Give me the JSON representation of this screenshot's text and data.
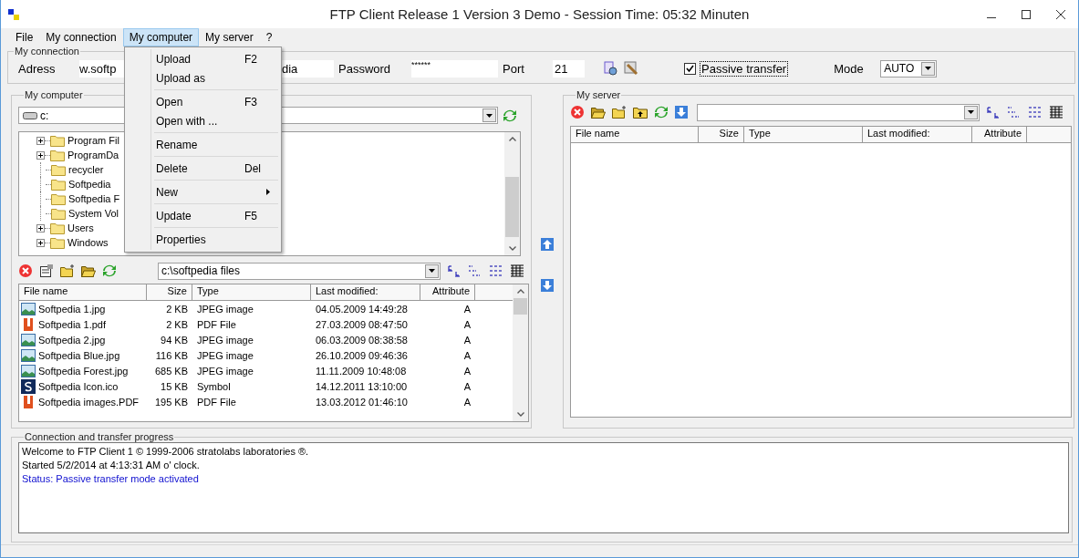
{
  "window": {
    "title": "FTP Client Release 1 Version 3 Demo - Session Time: 05:32 Minuten"
  },
  "menubar": [
    {
      "label": "File",
      "selected": false
    },
    {
      "label": "My connection",
      "selected": false
    },
    {
      "label": "My computer",
      "selected": true
    },
    {
      "label": "My server",
      "selected": false
    },
    {
      "label": "?",
      "selected": false
    }
  ],
  "menu": {
    "groups": [
      [
        {
          "label": "Upload",
          "shortcut": "F2",
          "submenu": false
        },
        {
          "label": "Upload as",
          "submenu": false
        }
      ],
      [
        {
          "label": "Open",
          "shortcut": "F3",
          "submenu": false
        },
        {
          "label": "Open with ...",
          "submenu": false
        }
      ],
      [
        {
          "label": "Rename",
          "submenu": false
        }
      ],
      [
        {
          "label": "Delete",
          "shortcut": "Del",
          "submenu": false
        }
      ],
      [
        {
          "label": "New",
          "submenu": true
        }
      ],
      [
        {
          "label": "Update",
          "shortcut": "F5",
          "submenu": false
        }
      ],
      [
        {
          "label": "Properties",
          "submenu": false
        }
      ]
    ]
  },
  "connection": {
    "title": "My connection",
    "address_label": "Adress",
    "address": "w.softp",
    "user": "dia",
    "password_label": "Password",
    "password": "******",
    "port_label": "Port",
    "port": "21",
    "passive": {
      "label": "Passive transfer",
      "checked": true
    },
    "mode_label": "Mode",
    "mode": "AUTO"
  },
  "left_panel": {
    "title": "My computer",
    "drive": "c:",
    "tree": [
      {
        "label": "Program Fil",
        "expandable": true
      },
      {
        "label": "ProgramDa",
        "expandable": true
      },
      {
        "label": "recycler",
        "expandable": false
      },
      {
        "label": "Softpedia",
        "expandable": false
      },
      {
        "label": "Softpedia F",
        "expandable": false
      },
      {
        "label": "System Vol",
        "expandable": false
      },
      {
        "label": "Users",
        "expandable": true
      },
      {
        "label": "Windows",
        "expandable": true
      }
    ],
    "path": "c:\\softpedia files",
    "columns": [
      "File name",
      "Size",
      "Type",
      "Last modified:",
      "Attribute"
    ],
    "rows": [
      {
        "kind": "image",
        "name": "Softpedia 1.jpg",
        "size": "2 KB",
        "type": "JPEG image",
        "modified": "04.05.2009 14:49:28",
        "attribute": "A"
      },
      {
        "kind": "pdf",
        "name": "Softpedia 1.pdf",
        "size": "2 KB",
        "type": "PDF File",
        "modified": "27.03.2009 08:47:50",
        "attribute": "A"
      },
      {
        "kind": "image",
        "name": "Softpedia 2.jpg",
        "size": "94 KB",
        "type": "JPEG image",
        "modified": "06.03.2009 08:38:58",
        "attribute": "A"
      },
      {
        "kind": "image",
        "name": "Softpedia Blue.jpg",
        "size": "116 KB",
        "type": "JPEG image",
        "modified": "26.10.2009 09:46:36",
        "attribute": "A"
      },
      {
        "kind": "image",
        "name": "Softpedia Forest.jpg",
        "size": "685 KB",
        "type": "JPEG image",
        "modified": "11.11.2009 10:48:08",
        "attribute": "A"
      },
      {
        "kind": "icon",
        "name": "Softpedia Icon.ico",
        "size": "15 KB",
        "type": "Symbol",
        "modified": "14.12.2011 13:10:00",
        "attribute": "A"
      },
      {
        "kind": "pdf",
        "name": "Softpedia images.PDF",
        "size": "195 KB",
        "type": "PDF File",
        "modified": "13.03.2012 01:46:10",
        "attribute": "A"
      }
    ]
  },
  "right_panel": {
    "title": "My server",
    "columns": [
      "File name",
      "Size",
      "Type",
      "Last modified:",
      "Attribute"
    ]
  },
  "progress": {
    "title": "Connection and transfer progress",
    "lines": [
      {
        "kind": "info",
        "text": "Welcome to FTP Client 1 © 1999-2006 stratolabs laboratories ®."
      },
      {
        "kind": "info",
        "text": "Started 5/2/2014 at 4:13:31 AM o' clock."
      },
      {
        "kind": "status",
        "text": "Status: Passive transfer mode activated"
      }
    ]
  }
}
